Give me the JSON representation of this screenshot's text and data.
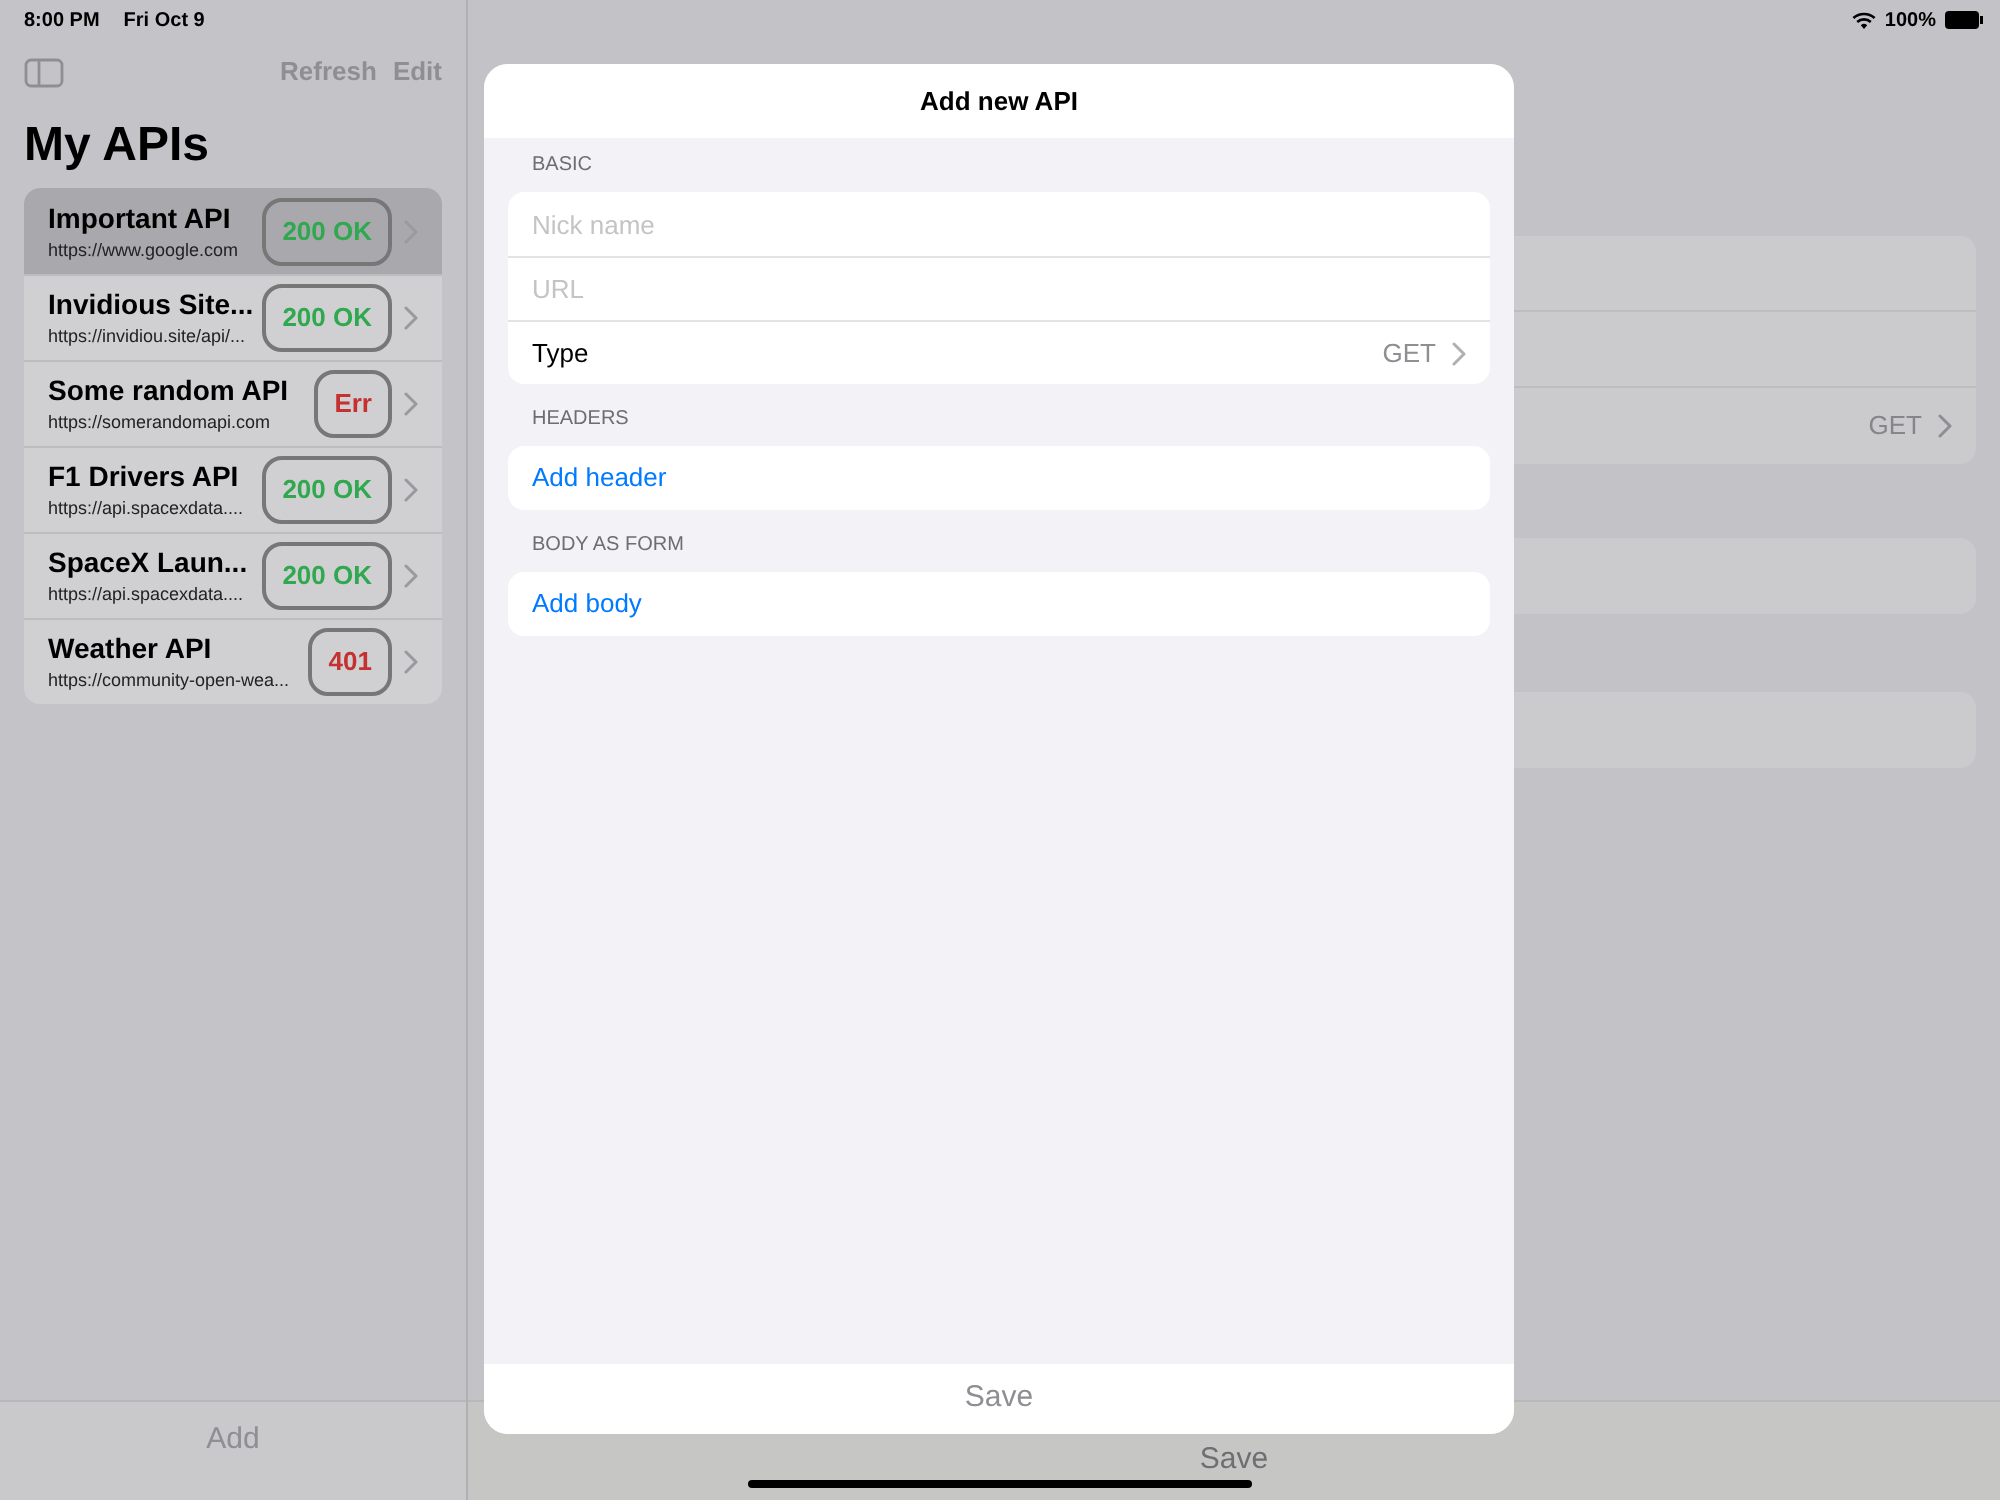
{
  "status_bar": {
    "time": "8:00 PM",
    "date": "Fri Oct 9",
    "battery": "100%"
  },
  "sidebar": {
    "actions": [
      "Refresh",
      "Edit"
    ],
    "title": "My APIs",
    "items": [
      {
        "name": "Important API",
        "url": "https://www.google.com",
        "status": "200 OK",
        "color": "#2fa84f",
        "selected": true
      },
      {
        "name": "Invidious Site...",
        "url": "https://invidiou.site/api/...",
        "status": "200 OK",
        "color": "#2fa84f",
        "selected": false
      },
      {
        "name": "Some random API",
        "url": "https://somerandomapi.com",
        "status": "Err",
        "color": "#c53030",
        "selected": false
      },
      {
        "name": "F1 Drivers API",
        "url": "https://api.spacexdata....",
        "status": "200 OK",
        "color": "#2fa84f",
        "selected": false
      },
      {
        "name": "SpaceX Laun...",
        "url": "https://api.spacexdata....",
        "status": "200 OK",
        "color": "#2fa84f",
        "selected": false
      },
      {
        "name": "Weather API",
        "url": "https://community-open-wea...",
        "status": "401",
        "color": "#c53030",
        "selected": false
      }
    ],
    "bottom_button": "Add"
  },
  "detail": {
    "type_value": "GET",
    "bottom_button": "Save"
  },
  "modal": {
    "title": "Add new API",
    "sections": [
      {
        "header": "BASIC",
        "rows": [
          {
            "kind": "input",
            "placeholder": "Nick name"
          },
          {
            "kind": "input",
            "placeholder": "URL"
          },
          {
            "kind": "picker",
            "label": "Type",
            "value": "GET"
          }
        ]
      },
      {
        "header": "HEADERS",
        "rows": [
          {
            "kind": "action",
            "label": "Add header"
          }
        ]
      },
      {
        "header": "BODY AS FORM",
        "rows": [
          {
            "kind": "action",
            "label": "Add body"
          }
        ]
      }
    ],
    "save": {
      "label": "Save",
      "disabled": true
    }
  }
}
